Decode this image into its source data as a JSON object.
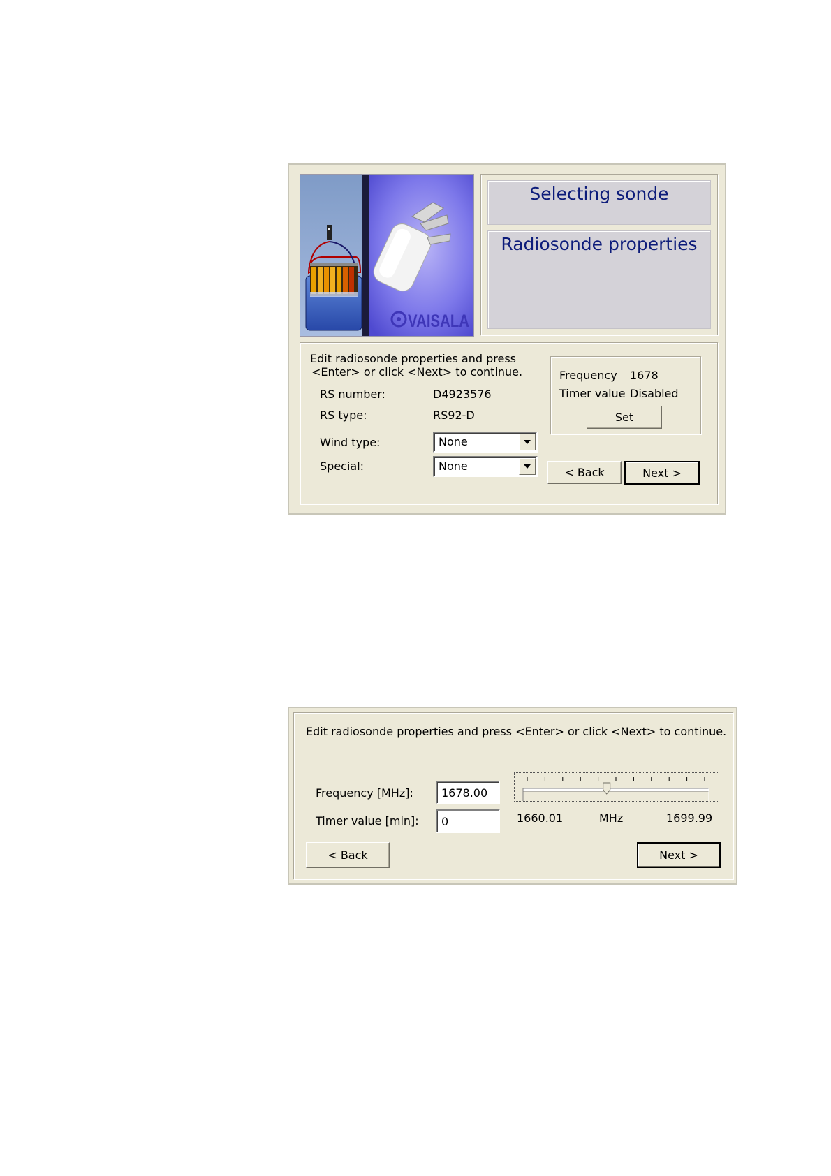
{
  "dialog1": {
    "title": "Selecting sonde",
    "subtitle": "Radiosonde properties",
    "logo_text": "VAISALA",
    "instructions": [
      "Edit radiosonde properties and press",
      "<Enter> or click <Next> to continue."
    ],
    "rs_number_label": "RS number:",
    "rs_number_value": "D4923576",
    "rs_type_label": "RS type:",
    "rs_type_value": "RS92-D",
    "wind_type_label": "Wind type:",
    "wind_type_value": "None",
    "special_label": "Special:",
    "special_value": "None",
    "frequency_label": "Frequency",
    "frequency_value": "1678",
    "timer_label": "Timer value",
    "timer_value": "Disabled",
    "set_button": "Set",
    "back_button": "< Back",
    "next_button": "Next >"
  },
  "dialog2": {
    "instructions": "Edit radiosonde properties and press <Enter> or click <Next> to continue.",
    "frequency_label": "Frequency [MHz]:",
    "frequency_value": "1678.00",
    "timer_label": "Timer value [min]:",
    "timer_value": "0",
    "slider_min": "1660.01",
    "slider_unit": "MHz",
    "slider_max": "1699.99",
    "slider_level": 0.45,
    "back_button": "< Back",
    "next_button": "Next >"
  },
  "colors": {
    "dialog_bg": "#ece9d8",
    "title_text": "#0d1c7a",
    "title_panel_bg": "#d4d2d8"
  }
}
